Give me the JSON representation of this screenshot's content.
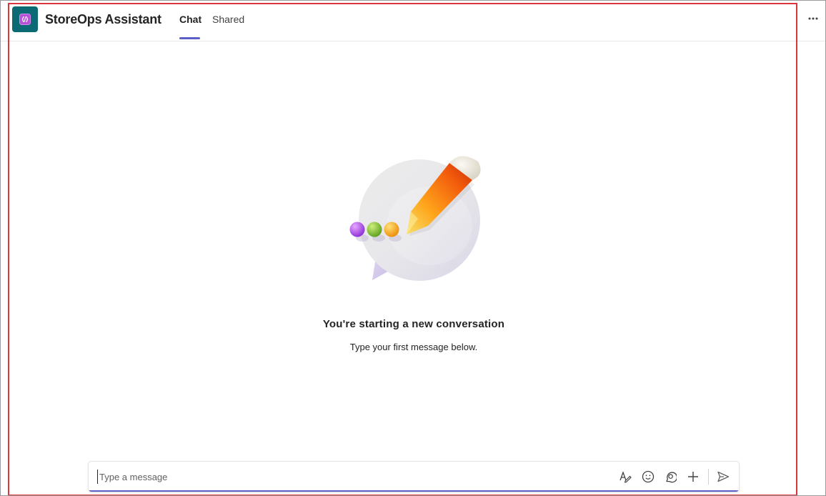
{
  "header": {
    "app_title": "StoreOps Assistant",
    "app_icon": "code-bracket-icon",
    "brand_color": "#0b6a73",
    "accent_color": "#5b5fc7",
    "tabs": [
      {
        "label": "Chat",
        "active": true
      },
      {
        "label": "Shared",
        "active": false
      }
    ],
    "more_icon": "more-options-icon"
  },
  "empty_state": {
    "illustration": "chat-bubble-pencil-illustration",
    "title": "You're starting a new conversation",
    "subtitle": "Type your first message below."
  },
  "composer": {
    "placeholder": "Type a message",
    "value": "",
    "tools": [
      "format-icon",
      "emoji-icon",
      "loop-icon",
      "attach-icon",
      "send-icon"
    ]
  }
}
